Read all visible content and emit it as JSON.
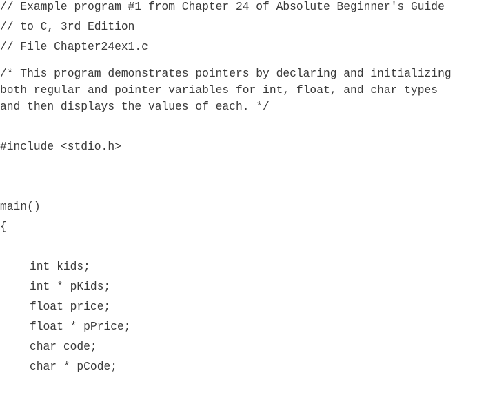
{
  "code": {
    "header_comments": [
      "// Example program #1 from Chapter 24 of Absolute Beginner's Guide",
      "// to C, 3rd Edition",
      "// File Chapter24ex1.c"
    ],
    "block_comment": [
      "/* This program demonstrates pointers by declaring and initializing",
      "both regular and pointer variables for int, float, and char types",
      "and then displays the values of each. */"
    ],
    "include": "#include <stdio.h>",
    "main_signature": "main()",
    "open_brace": "{",
    "declarations": [
      "int kids;",
      "int * pKids;",
      "float price;",
      "float * pPrice;",
      "char code;",
      "char * pCode;"
    ]
  }
}
